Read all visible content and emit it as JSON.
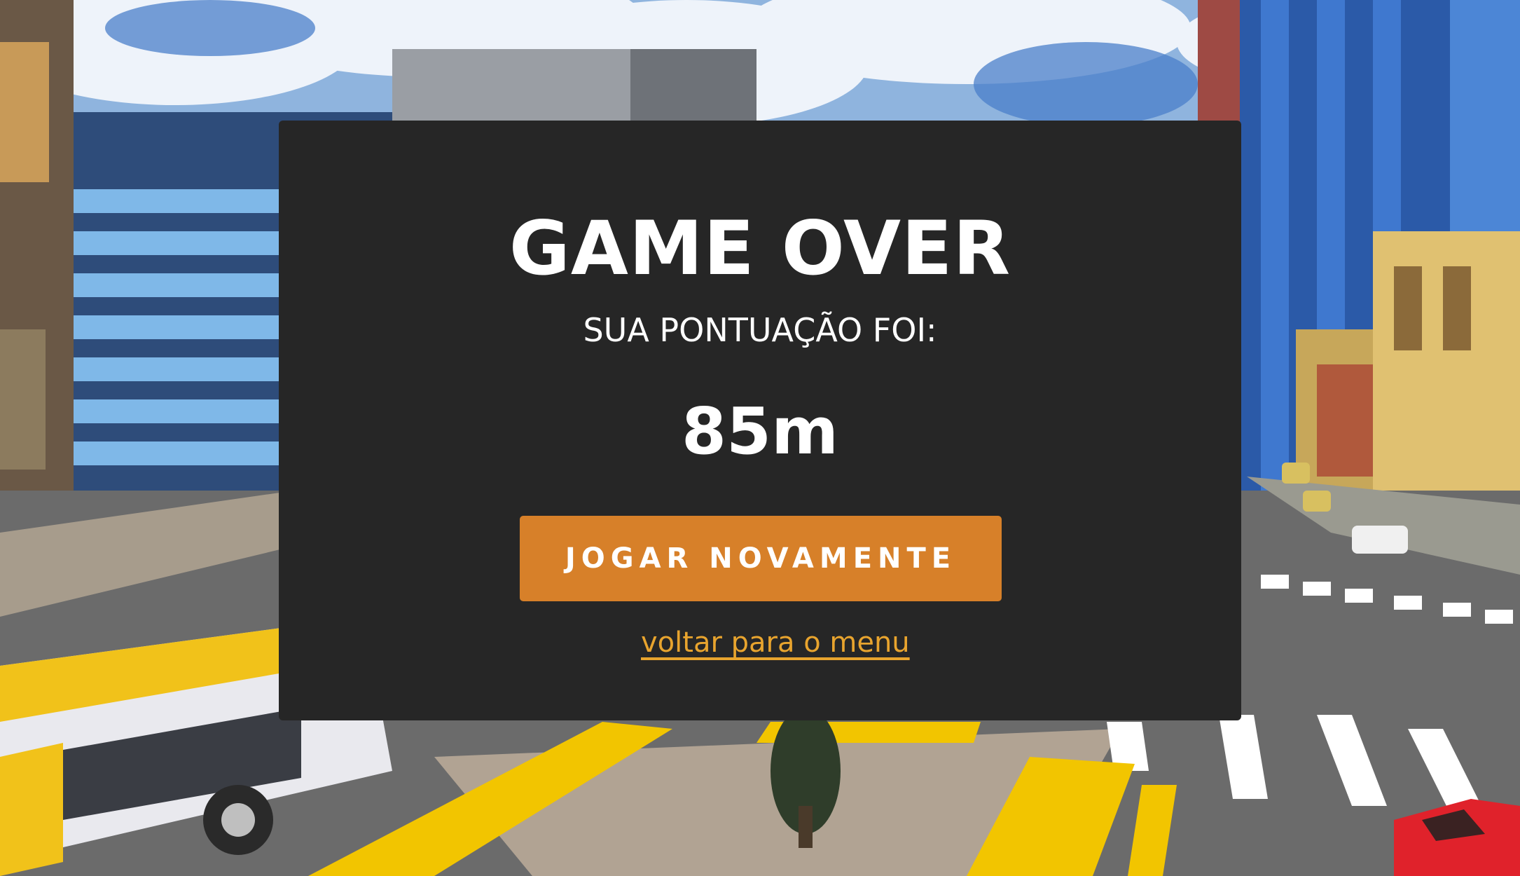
{
  "game_over": {
    "title": "GAME OVER",
    "score_label": "SUA PONTUAÇÃO FOI:",
    "score_value": "85m",
    "play_again_label": "JOGAR NOVAMENTE",
    "back_to_menu_label": "voltar para o menu"
  },
  "colors": {
    "dialog_bg": "#262626",
    "button_bg": "#d78029",
    "link": "#e8a42e",
    "text": "#ffffff"
  }
}
